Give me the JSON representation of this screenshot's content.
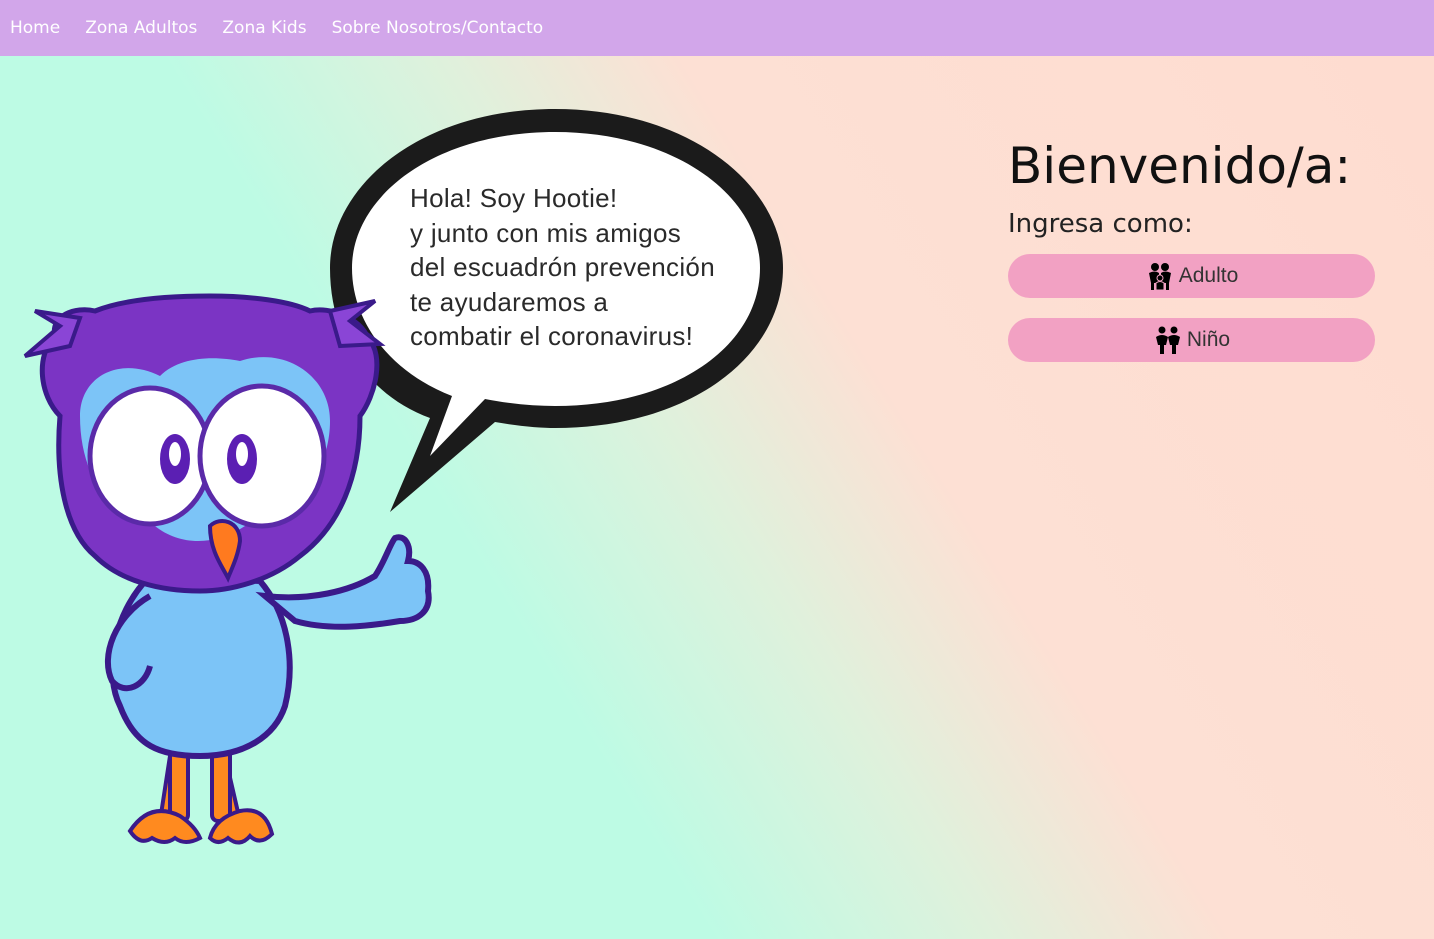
{
  "nav": {
    "items": [
      {
        "label": "Home"
      },
      {
        "label": "Zona Adultos"
      },
      {
        "label": "Zona Kids"
      },
      {
        "label": "Sobre Nosotros/Contacto"
      }
    ]
  },
  "speech": {
    "lines": [
      "Hola! Soy Hootie!",
      "y junto con mis amigos",
      "del escuadrón prevención",
      "te ayudaremos a",
      "combatir el coronavirus!"
    ]
  },
  "welcome": {
    "title": "Bienvenido/a:",
    "subtitle": "Ingresa como:",
    "adult_button": {
      "label": "Adulto",
      "icon": "family-icon"
    },
    "child_button": {
      "label": "Niño",
      "icon": "children-icon"
    }
  },
  "colors": {
    "nav_bg": "#d2a6ea",
    "button_bg": "#f2a1c3",
    "gradient_left": "#bdfbe4",
    "gradient_right": "#fedcd0"
  }
}
